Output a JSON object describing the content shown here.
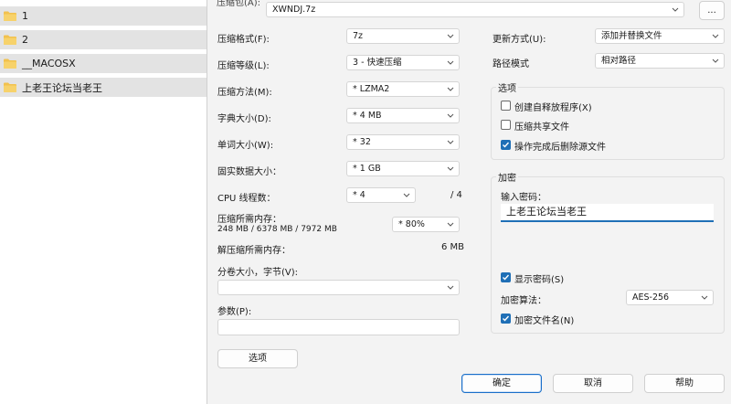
{
  "explorer": {
    "folders": [
      "1",
      "2",
      "__MACOSX",
      "上老王论坛当老王"
    ],
    "folder_color": "#f2c14e"
  },
  "dialog": {
    "archive_label": "压缩包(A):",
    "archive_value": "XWNDJ.7z",
    "browse_label": "...",
    "format": {
      "label": "压缩格式(F):",
      "value": "7z"
    },
    "level": {
      "label": "压缩等级(L):",
      "value": "3 - 快速压缩"
    },
    "method": {
      "label": "压缩方法(M):",
      "value": "* LZMA2"
    },
    "dict": {
      "label": "字典大小(D):",
      "value": "* 4 MB"
    },
    "word": {
      "label": "单词大小(W):",
      "value": "* 32"
    },
    "solid": {
      "label": "固实数据大小：",
      "value": "* 1 GB"
    },
    "cpu": {
      "label": "CPU 线程数：",
      "value": "* 4",
      "max": "/ 4"
    },
    "mem_compress": {
      "label": "压缩所需内存：",
      "detail": "248 MB / 6378 MB / 7972 MB",
      "value": "* 80%"
    },
    "mem_decompress": {
      "label": "解压缩所需内存：",
      "value": "6 MB"
    },
    "volume": {
      "label": "分卷大小，字节(V):",
      "value": ""
    },
    "params": {
      "label": "参数(P):",
      "value": ""
    },
    "options_button": "选项",
    "update_mode": {
      "label": "更新方式(U):",
      "value": "添加并替换文件"
    },
    "path_mode": {
      "label": "路径模式",
      "value": "相对路径"
    },
    "options_group": {
      "title": "选项",
      "items": [
        {
          "label": "创建自释放程序(X)",
          "checked": false
        },
        {
          "label": "压缩共享文件",
          "checked": false
        },
        {
          "label": "操作完成后删除源文件",
          "checked": true
        }
      ]
    },
    "encryption": {
      "title": "加密",
      "password_label": "输入密码：",
      "password_value": "上老王论坛当老王",
      "show_password": {
        "label": "显示密码(S)",
        "checked": true
      },
      "method_label": "加密算法：",
      "method_value": "AES-256",
      "encrypt_names": {
        "label": "加密文件名(N)",
        "checked": true
      }
    },
    "buttons": {
      "ok": "确定",
      "cancel": "取消",
      "help": "帮助"
    },
    "accent_color": "#1f6fb6"
  }
}
